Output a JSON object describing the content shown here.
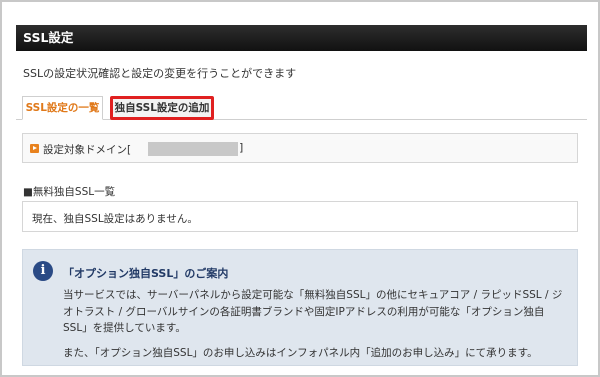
{
  "header": {
    "title": "SSL設定"
  },
  "intro": {
    "text": "SSLの設定状況確認と設定の変更を行うことができます"
  },
  "tabs": [
    {
      "label": "SSL設定の一覧",
      "active": true
    },
    {
      "label": "独自SSL設定の追加",
      "active": false,
      "highlighted": true
    }
  ],
  "domain": {
    "label": "設定対象ドメイン[",
    "close_bracket": "]"
  },
  "list": {
    "title": "■無料独自SSL一覧",
    "empty_message": "現在、独自SSL設定はありません。"
  },
  "notice": {
    "title": "「オプション独自SSL」のご案内",
    "paragraph1": "当サービスでは、サーバーパネルから設定可能な「無料独自SSL」の他にセキュアコア / ラピッドSSL / ジオトラスト / グローバルサインの各証明書ブランドや固定IPアドレスの利用が可能な「オプション独自SSL」を提供しています。",
    "paragraph2": "また、「オプション独自SSL」のお申し込みはインフォパネル内「追加のお申し込み」にて承ります。"
  },
  "colors": {
    "header_bg": "#1a1a1a",
    "active_tab": "#e0791a",
    "highlight_border": "#e02020",
    "notice_bg": "#dfe6ee",
    "info_icon": "#2a4a85"
  },
  "icons": {
    "domain_marker": "play-square-icon",
    "notice": "info-icon"
  }
}
